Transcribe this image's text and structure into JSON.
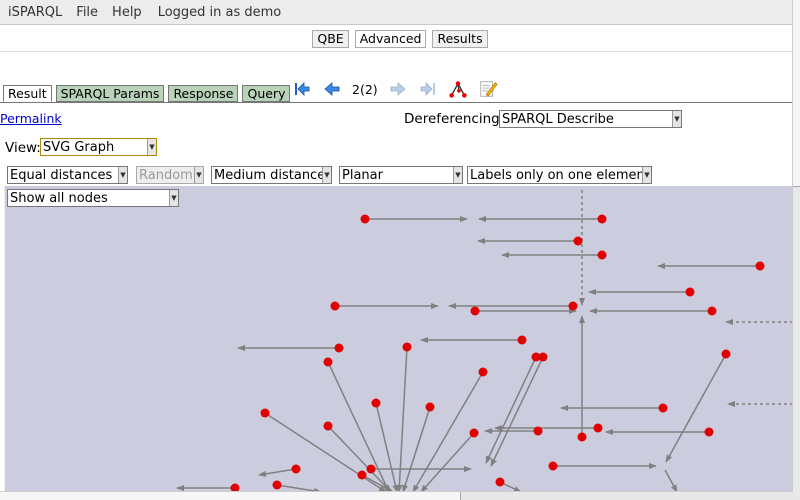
{
  "menubar": {
    "app": "iSPARQL",
    "file": "File",
    "help": "Help",
    "logged": "Logged in as demo"
  },
  "top_tabs": [
    "QBE",
    "Advanced",
    "Results"
  ],
  "tabs": [
    "Result",
    "SPARQL Params",
    "Response",
    "Query"
  ],
  "pager": "2(2)",
  "permalink": "Permalink",
  "dereferencing": {
    "label": "Dereferencing:",
    "value": "SPARQL Describe"
  },
  "view": {
    "label": "View:",
    "value": "SVG Graph"
  },
  "options": {
    "distance": "Equal distances",
    "random": "Random",
    "medium": "Medium distance",
    "layout": "Planar",
    "labels": "Labels only on one element",
    "nodes": "Show all nodes"
  },
  "graph": {
    "node_color": "#e00000",
    "edge_color": "#808080",
    "background": "#ccccdf"
  }
}
